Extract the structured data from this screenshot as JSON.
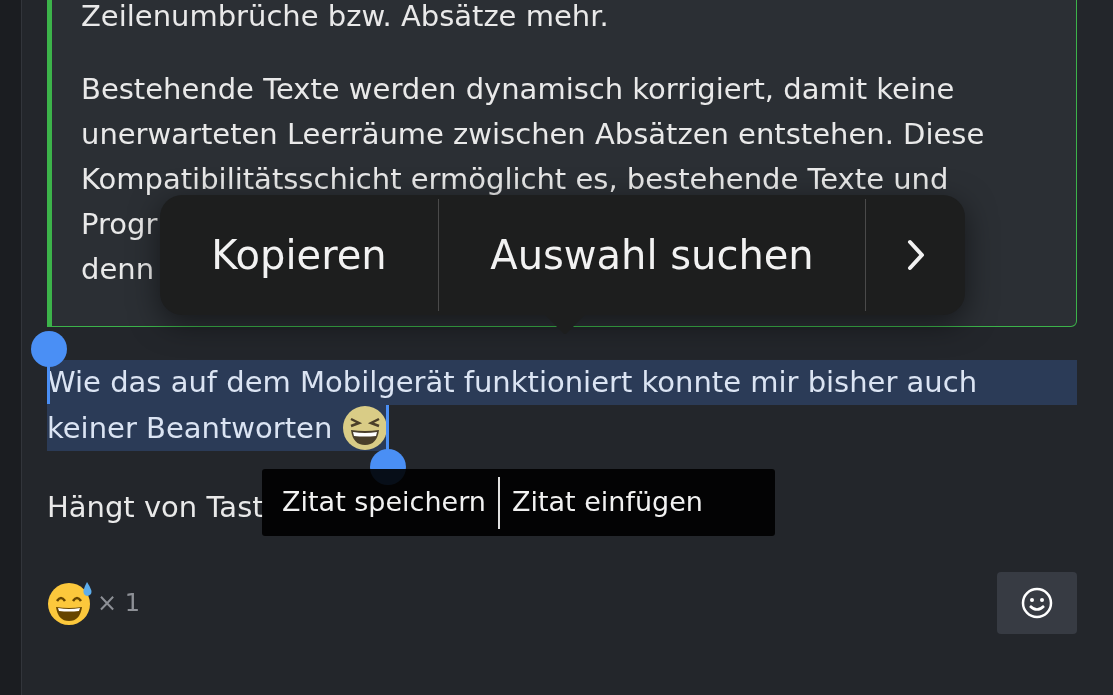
{
  "quote": {
    "paragraphs": [
      {
        "lines": [
          "Zeilenumbrüche bzw. Absätze mehr."
        ]
      },
      {
        "lines": [
          "Bestehende Texte werden dynamisch korrigiert, damit keine",
          "unerwarteten Leerräume zwischen Absätzen entstehen. Diese",
          "Kompatibilitätsschicht ermöglicht es, bestehende Texte und",
          "Progr",
          "denn"
        ]
      }
    ]
  },
  "post": {
    "paragraphs": [
      {
        "lines": [
          "Wie das auf dem Mobilgerät funktioniert konnte mir bisher auch",
          "keiner Beantworten"
        ],
        "selected": true
      },
      {
        "lines": [
          "Hängt von Tast"
        ],
        "selected": false
      }
    ]
  },
  "context_menu": {
    "items": [
      "Kopieren",
      "Auswahl suchen"
    ]
  },
  "quote_popup": {
    "buttons": [
      "Zitat speichern",
      "Zitat einfügen"
    ]
  },
  "reactions": [
    {
      "count": "× 1"
    }
  ]
}
